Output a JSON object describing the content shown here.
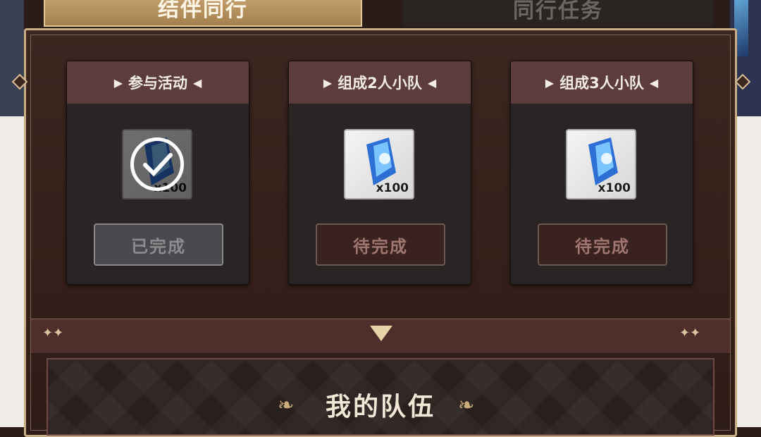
{
  "tabs": {
    "left_label": "结伴同行",
    "right_label": "同行任务"
  },
  "tasks": [
    {
      "title": "参与活动",
      "quantity": "x100",
      "status": "已完成",
      "completed": true
    },
    {
      "title": "组成2人小队",
      "quantity": "x100",
      "status": "待完成",
      "completed": false
    },
    {
      "title": "组成3人小队",
      "quantity": "x100",
      "status": "待完成",
      "completed": false
    }
  ],
  "team": {
    "title": "我的队伍"
  },
  "colors": {
    "panel_bg": "#3b2620",
    "card_header": "#5c3c3c",
    "accent_gold": "#c8ad85"
  }
}
